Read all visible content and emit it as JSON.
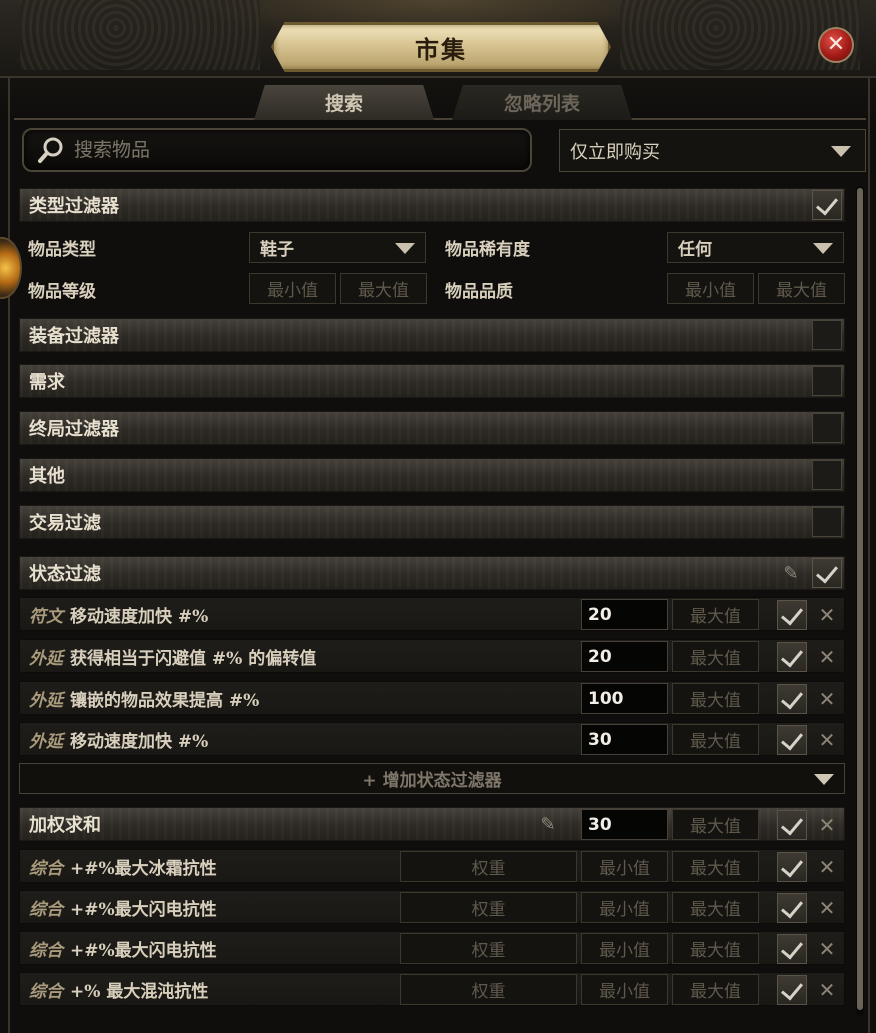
{
  "window": {
    "title": "市集",
    "close_icon": "close-icon"
  },
  "tabs": [
    {
      "label": "搜索",
      "active": true
    },
    {
      "label": "忽略列表",
      "active": false
    }
  ],
  "search": {
    "placeholder": "搜索物品",
    "icon": "search-icon"
  },
  "buyout": {
    "selected": "仅立即购买"
  },
  "type_filters": {
    "header": "类型过滤器",
    "checked": true,
    "item_type_label": "物品类型",
    "item_type_value": "鞋子",
    "rarity_label": "物品稀有度",
    "rarity_value": "任何",
    "level_label": "物品等级",
    "quality_label": "物品品质",
    "min_placeholder": "最小值",
    "max_placeholder": "最大值"
  },
  "collapsed_sections": [
    {
      "label": "装备过滤器",
      "checked": false
    },
    {
      "label": "需求",
      "checked": false
    },
    {
      "label": "终局过滤器",
      "checked": false
    },
    {
      "label": "其他",
      "checked": false
    },
    {
      "label": "交易过滤",
      "checked": false
    }
  ],
  "stat_filters": {
    "header": "状态过滤",
    "checked": true,
    "rows": [
      {
        "tag": "符文",
        "text": "移动速度加快 #%",
        "min": "20",
        "max_placeholder": "最大值",
        "checked": true
      },
      {
        "tag": "外延",
        "text": "获得相当于闪避值 #% 的偏转值",
        "min": "20",
        "max_placeholder": "最大值",
        "checked": true
      },
      {
        "tag": "外延",
        "text": "镶嵌的物品效果提高 #%",
        "min": "100",
        "max_placeholder": "最大值",
        "checked": true
      },
      {
        "tag": "外延",
        "text": "移动速度加快 #%",
        "min": "30",
        "max_placeholder": "最大值",
        "checked": true
      }
    ],
    "add_label": "+ 增加状态过滤器"
  },
  "weighted_sum": {
    "header": "加权求和",
    "min": "30",
    "max_placeholder": "最大值",
    "checked": true,
    "rows": [
      {
        "tag": "综合",
        "text": "+#%最大冰霜抗性",
        "weight_placeholder": "权重",
        "min_placeholder": "最小值",
        "max_placeholder": "最大值",
        "checked": true
      },
      {
        "tag": "综合",
        "text": "+#%最大闪电抗性",
        "weight_placeholder": "权重",
        "min_placeholder": "最小值",
        "max_placeholder": "最大值",
        "checked": true
      },
      {
        "tag": "综合",
        "text": "+#%最大闪电抗性",
        "weight_placeholder": "权重",
        "min_placeholder": "最小值",
        "max_placeholder": "最大值",
        "checked": true
      },
      {
        "tag": "综合",
        "text": "+% 最大混沌抗性",
        "weight_placeholder": "权重",
        "min_placeholder": "最小值",
        "max_placeholder": "最大值",
        "checked": true
      }
    ]
  },
  "colors": {
    "accent_gold": "#d7c492",
    "close_red": "#a31c17",
    "panel": "#2d2a25"
  }
}
